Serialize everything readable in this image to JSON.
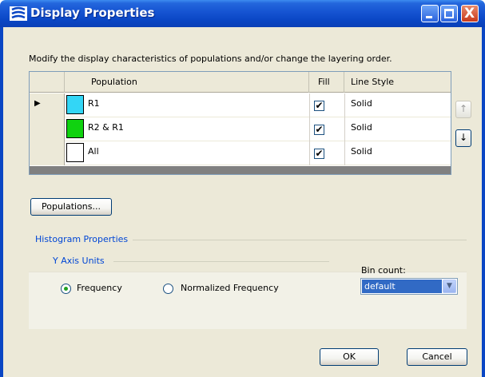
{
  "window": {
    "title": "Display Properties",
    "buttons": {
      "minimize": "minimize",
      "maximize": "maximize",
      "close": "X"
    }
  },
  "description": "Modify the display characteristics of populations and/or change the layering order.",
  "grid": {
    "columns": {
      "population": "Population",
      "fill": "Fill",
      "line_style": "Line Style"
    },
    "rows": [
      {
        "color": "#33d6f6",
        "name": "R1",
        "fill": "✔",
        "line_style": "Solid",
        "current": "▶"
      },
      {
        "color": "#10d210",
        "name": "R2 & R1",
        "fill": "✔",
        "line_style": "Solid",
        "current": ""
      },
      {
        "color": "#ffffff",
        "name": "All",
        "fill": "✔",
        "line_style": "Solid",
        "current": ""
      }
    ],
    "move_up_icon": "↑",
    "move_down_icon": "↓"
  },
  "populations_button": "Populations...",
  "histogram": {
    "title": "Histogram Properties",
    "y_axis_units_title": "Y Axis Units",
    "options": {
      "frequency": "Frequency",
      "normalized": "Normalized Frequency"
    },
    "selected": "frequency",
    "bin_count_label": "Bin count:",
    "bin_count_value": "default"
  },
  "footer": {
    "ok": "OK",
    "cancel": "Cancel"
  },
  "colors": {
    "titlebar": "#0a46c4",
    "accent": "#0046d5",
    "selection": "#316ac5"
  }
}
